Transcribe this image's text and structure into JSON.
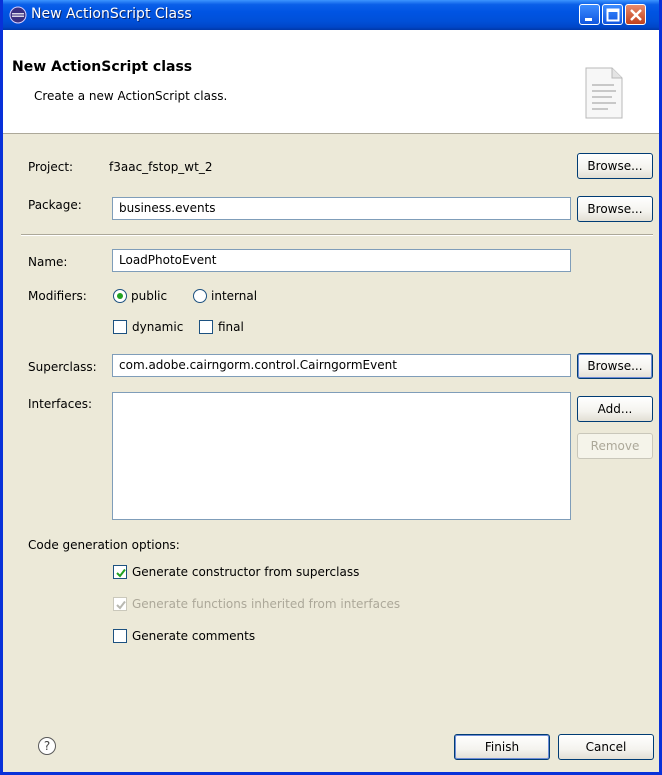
{
  "window": {
    "title": "New ActionScript Class"
  },
  "header": {
    "title": "New ActionScript class",
    "description": "Create a new ActionScript class."
  },
  "form": {
    "project_label": "Project:",
    "project_value": "f3aac_fstop_wt_2",
    "package_label": "Package:",
    "package_value": "business.events",
    "name_label": "Name:",
    "name_value": "LoadPhotoEvent",
    "modifiers_label": "Modifiers:",
    "modifier_public": "public",
    "modifier_internal": "internal",
    "modifier_dynamic": "dynamic",
    "modifier_final": "final",
    "superclass_label": "Superclass:",
    "superclass_value": "com.adobe.cairngorm.control.CairngormEvent",
    "interfaces_label": "Interfaces:",
    "browse_label": "Browse...",
    "add_label": "Add...",
    "remove_label": "Remove",
    "codegen_label": "Code generation options:",
    "gen_constructor": "Generate constructor from superclass",
    "gen_functions": "Generate functions inherited from interfaces",
    "gen_comments": "Generate comments"
  },
  "state": {
    "public_selected": true,
    "internal_selected": false,
    "dynamic_checked": false,
    "final_checked": false,
    "gen_constructor_checked": true,
    "gen_functions_checked": true,
    "gen_functions_enabled": false,
    "gen_comments_checked": false
  },
  "footer": {
    "help_glyph": "?",
    "finish_label": "Finish",
    "cancel_label": "Cancel"
  },
  "colors": {
    "title_bar": "#0054e3",
    "dialog_bg": "#ece9d8",
    "check_mark": "#21a121"
  }
}
